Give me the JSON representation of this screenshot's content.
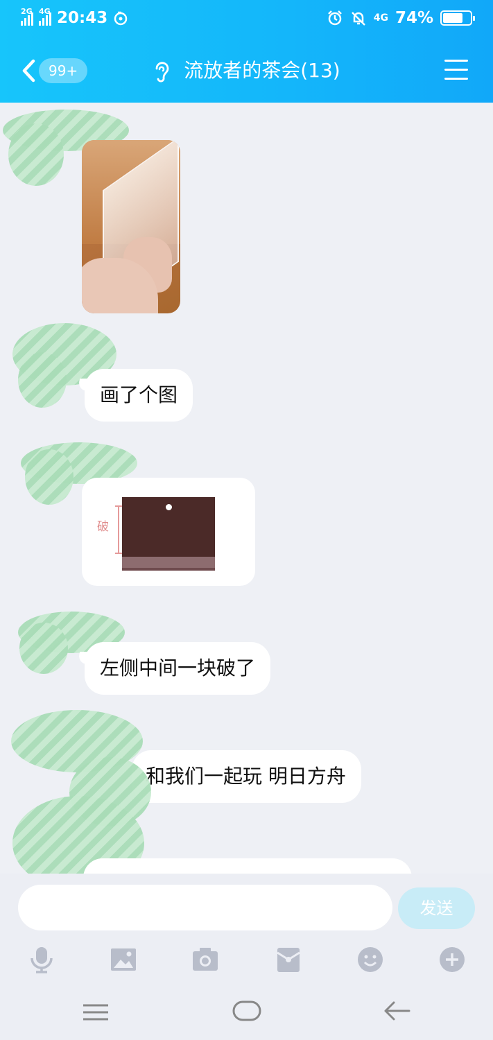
{
  "status_bar": {
    "network_1": "2G",
    "network_2": "4G",
    "time": "20:43",
    "network_3": "4G",
    "battery": "74%"
  },
  "header": {
    "unread_badge": "99+",
    "title": "流放者的茶会(13)"
  },
  "messages": [
    {
      "type": "image",
      "description_icon": "photo"
    },
    {
      "type": "text",
      "text": "画了个图"
    },
    {
      "type": "image",
      "annotation": "破"
    },
    {
      "type": "text",
      "text": "左侧中间一块破了"
    },
    {
      "type": "text",
      "text": "和我们一起玩 明日方舟"
    }
  ],
  "input": {
    "placeholder": "",
    "send_label": "发送"
  },
  "toolbar": {
    "icons": [
      "mic-icon",
      "image-icon",
      "camera-icon",
      "red-packet-icon",
      "emoji-icon",
      "plus-icon"
    ]
  },
  "colors": {
    "header_start": "#17c5fb",
    "header_end": "#11a8f9",
    "chat_bg": "#eef0f5",
    "send_disabled": "#c8ecf7",
    "icon_gray": "#b8bdca"
  }
}
